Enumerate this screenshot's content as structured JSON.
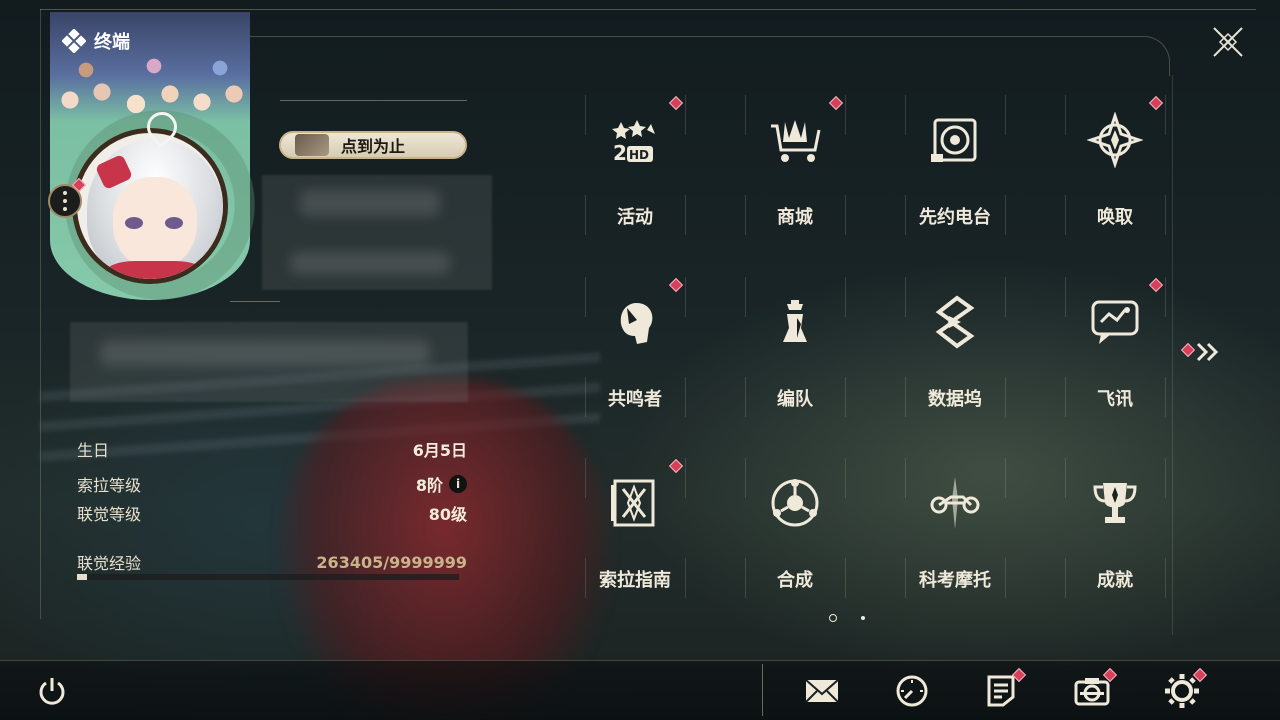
{
  "header": {
    "title": "终端"
  },
  "profile": {
    "badge_label": "点到为止"
  },
  "stats": [
    {
      "label": "生日",
      "value": "6月5日"
    },
    {
      "label": "索拉等级",
      "value": "8阶"
    },
    {
      "label": "联觉等级",
      "value": "80级"
    }
  ],
  "experience": {
    "label": "联觉经验",
    "value": "263405/9999999",
    "progress": 0.0263
  },
  "menu": [
    {
      "label": "活动",
      "icon": "event-2hd-icon",
      "alert": true
    },
    {
      "label": "商城",
      "icon": "shop-cart-icon",
      "alert": true
    },
    {
      "label": "先约电台",
      "icon": "radio-icon",
      "alert": false
    },
    {
      "label": "唤取",
      "icon": "convene-compass-icon",
      "alert": true
    },
    {
      "label": "共鸣者",
      "icon": "resonator-head-icon",
      "alert": true
    },
    {
      "label": "编队",
      "icon": "team-chess-icon",
      "alert": false
    },
    {
      "label": "数据坞",
      "icon": "data-bank-icon",
      "alert": false
    },
    {
      "label": "飞讯",
      "icon": "chat-message-icon",
      "alert": true
    },
    {
      "label": "索拉指南",
      "icon": "guidebook-icon",
      "alert": true
    },
    {
      "label": "合成",
      "icon": "synthesis-icon",
      "alert": false
    },
    {
      "label": "科考摩托",
      "icon": "motorbike-icon",
      "alert": false
    },
    {
      "label": "成就",
      "icon": "trophy-icon",
      "alert": false
    }
  ],
  "pagination": {
    "pages": 2,
    "current": 1
  },
  "bottom_bar": [
    {
      "name": "mail",
      "icon": "mail-icon",
      "alert": false
    },
    {
      "name": "time",
      "icon": "clock-icon",
      "alert": false
    },
    {
      "name": "notice",
      "icon": "notice-icon",
      "alert": true
    },
    {
      "name": "camera",
      "icon": "camera-icon",
      "alert": true
    },
    {
      "name": "settings",
      "icon": "gear-icon",
      "alert": true
    }
  ],
  "colors": {
    "accent": "#c9b48a",
    "alert": "#d8405a",
    "text": "#efe9da"
  }
}
